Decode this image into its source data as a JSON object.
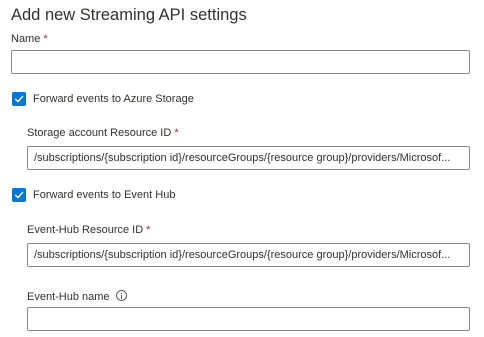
{
  "page": {
    "title": "Add new Streaming API settings"
  },
  "name_field": {
    "label": "Name",
    "required_marker": "*",
    "value": ""
  },
  "forward_storage": {
    "label": "Forward events to Azure Storage",
    "checked": true
  },
  "storage_resource": {
    "label": "Storage account Resource ID",
    "required_marker": "*",
    "value": "/subscriptions/{subscription id}/resourceGroups/{resource group}/providers/Microsof..."
  },
  "forward_eventhub": {
    "label": "Forward events to Event Hub",
    "checked": true
  },
  "eventhub_resource": {
    "label": "Event-Hub Resource ID",
    "required_marker": "*",
    "value": "/subscriptions/{subscription id}/resourceGroups/{resource group}/providers/Microsof..."
  },
  "eventhub_name": {
    "label": "Event-Hub name",
    "info_icon": "info-icon",
    "value": ""
  },
  "colors": {
    "accent": "#0078d4",
    "required": "#a4262c",
    "border": "#8a8886",
    "text": "#323130"
  }
}
